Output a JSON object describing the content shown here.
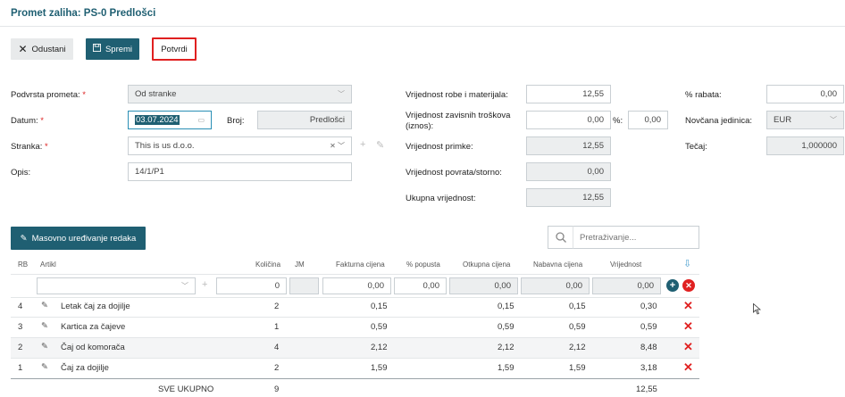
{
  "header": {
    "title": "Promet zaliha: PS-0 Predlošci"
  },
  "toolbar": {
    "cancel_label": "Odustani",
    "save_label": "Spremi",
    "confirm_label": "Potvrdi"
  },
  "form_left": {
    "prometa_label": "Podvrsta prometa:",
    "prometa_value": "Od stranke",
    "datum_label": "Datum:",
    "datum_value": "03.07.2024",
    "broj_label": "Broj:",
    "broj_value": "Predlošci",
    "stranka_label": "Stranka:",
    "stranka_value": "This is us d.o.o.",
    "opis_label": "Opis:",
    "opis_value": "14/1/P1"
  },
  "form_mid": {
    "robe_label": "Vrijednost robe i materijala:",
    "robe_value": "12,55",
    "zavisnih_label_1": "Vrijednost zavisnih troškova",
    "zavisnih_label_2": "(iznos):",
    "zavisnih_value": "0,00",
    "pct_label": "%:",
    "pct_value": "0,00",
    "primke_label": "Vrijednost primke:",
    "primke_value": "12,55",
    "povrata_label": "Vrijednost povrata/storno:",
    "povrata_value": "0,00",
    "ukupna_label": "Ukupna vrijednost:",
    "ukupna_value": "12,55"
  },
  "form_right": {
    "rabat_label": "% rabata:",
    "rabat_value": "0,00",
    "valuta_label": "Novčana jedinica:",
    "valuta_value": "EUR",
    "tecaj_label": "Tečaj:",
    "tecaj_value": "1,000000"
  },
  "mass_edit_label": "Masovno uređivanje redaka",
  "search": {
    "placeholder": "Pretraživanje..."
  },
  "table": {
    "headers": {
      "rb": "RB",
      "artikl": "Artikl",
      "kolicina": "Količina",
      "jm": "JM",
      "fakturna": "Fakturna cijena",
      "popust": "% popusta",
      "otkupna": "Otkupna cijena",
      "nabavna": "Nabavna cijena",
      "vrijednost": "Vrijednost"
    },
    "new_row": {
      "kolicina": "0",
      "fakturna": "0,00",
      "popust": "0,00",
      "otkupna": "0,00",
      "nabavna": "0,00",
      "vrijednost": "0,00"
    },
    "rows": [
      {
        "rb": "4",
        "artikl": "Letak čaj za dojilje",
        "kolicina": "2",
        "fakturna": "0,15",
        "otkupna": "0,15",
        "nabavna": "0,15",
        "vrijednost": "0,30"
      },
      {
        "rb": "3",
        "artikl": "Kartica za čajeve",
        "kolicina": "1",
        "fakturna": "0,59",
        "otkupna": "0,59",
        "nabavna": "0,59",
        "vrijednost": "0,59"
      },
      {
        "rb": "2",
        "artikl": "Čaj od komorača",
        "kolicina": "4",
        "fakturna": "2,12",
        "otkupna": "2,12",
        "nabavna": "2,12",
        "vrijednost": "8,48"
      },
      {
        "rb": "1",
        "artikl": "Čaj za dojilje",
        "kolicina": "2",
        "fakturna": "1,59",
        "otkupna": "1,59",
        "nabavna": "1,59",
        "vrijednost": "3,18"
      }
    ],
    "total": {
      "label": "SVE UKUPNO",
      "kolicina": "9",
      "vrijednost": "12,55"
    }
  },
  "colors": {
    "accent": "#1f5f72",
    "danger": "#e02020",
    "add": "#1f5f72"
  }
}
